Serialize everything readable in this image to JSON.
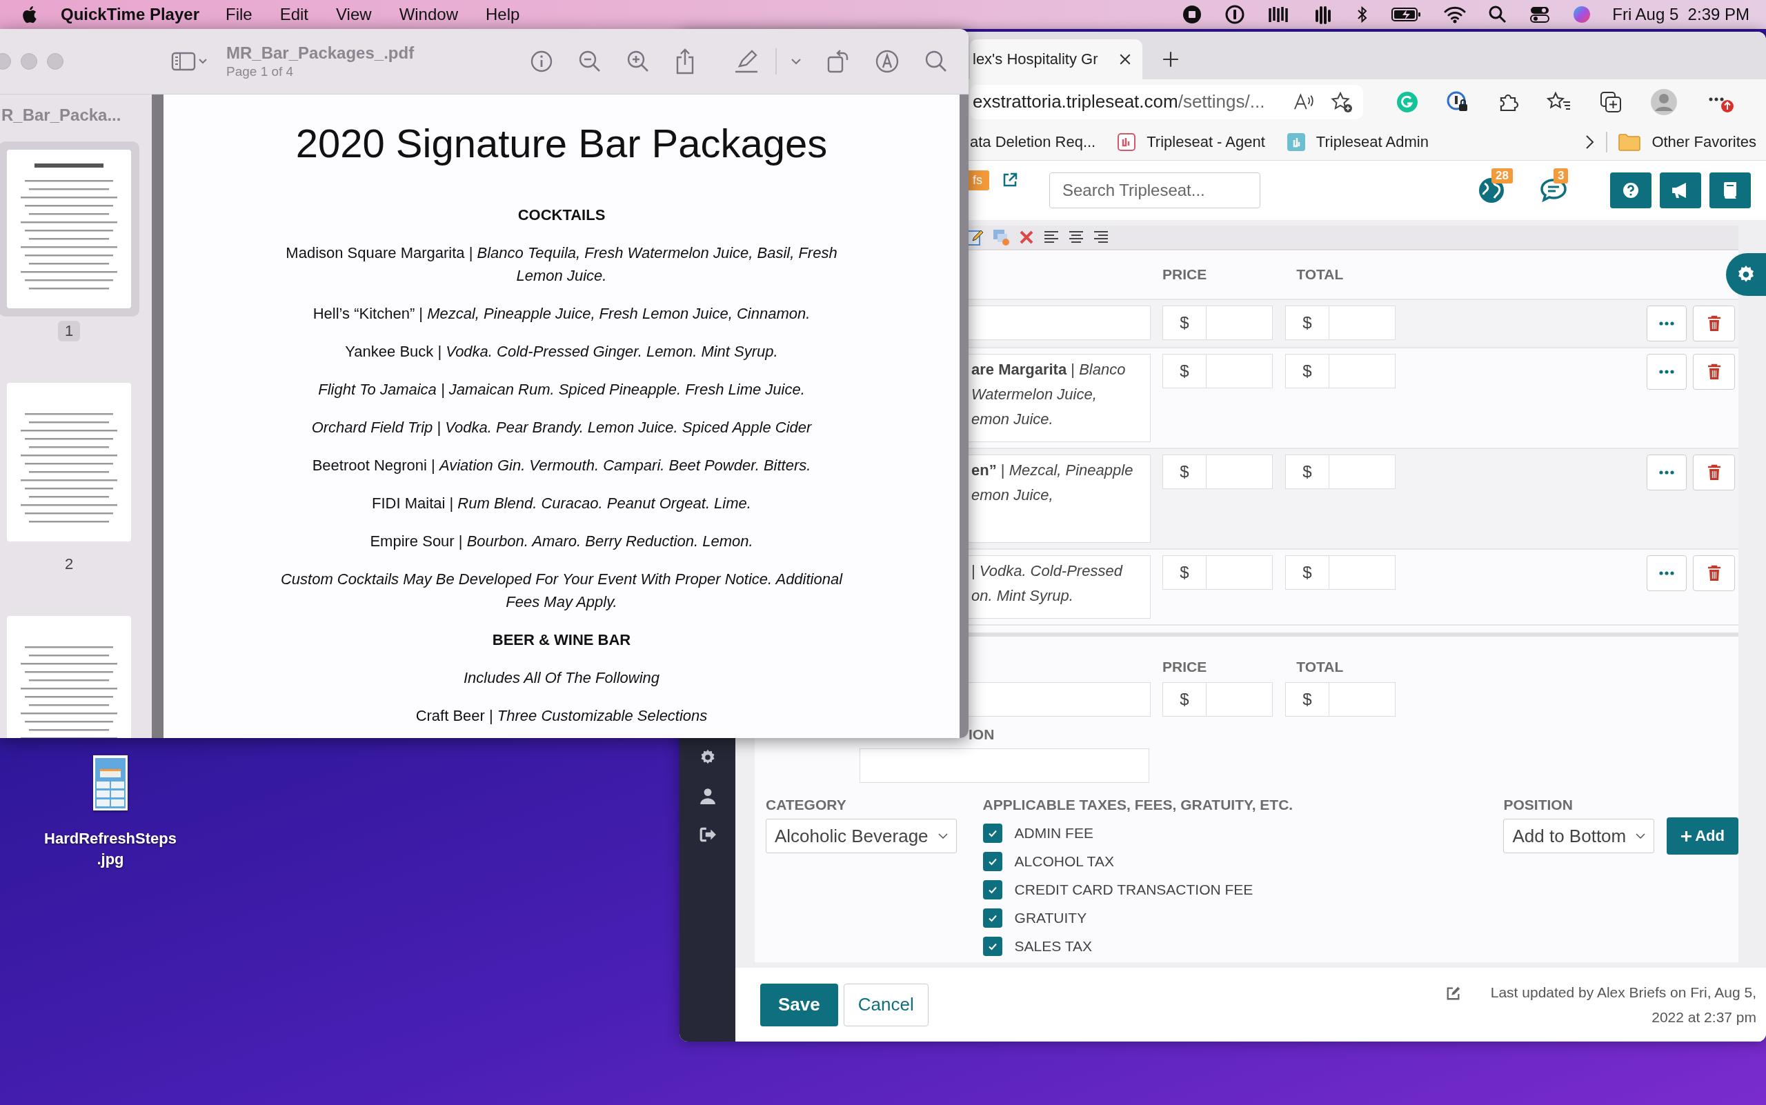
{
  "menubar": {
    "app": "QuickTime Player",
    "menus": [
      "File",
      "Edit",
      "View",
      "Window",
      "Help"
    ],
    "clock": "Fri Aug 5  2:39 PM"
  },
  "desktop": {
    "file_name": "HardRefreshSteps.jpg"
  },
  "preview": {
    "filename": "MR_Bar_Packages_.pdf",
    "page_info": "Page 1 of 4",
    "sidebar_title": "R_Bar_Packa...",
    "thumbnails": [
      {
        "number": "1",
        "selected": true
      },
      {
        "number": "2",
        "selected": false
      },
      {
        "selected": false
      }
    ],
    "document": {
      "title": "2020 Signature Bar Packages",
      "blocks": [
        {
          "kind": "heading",
          "text": "COCKTAILS"
        },
        {
          "kind": "item",
          "text": "Madison Square Margarita | *Blanco Tequila, Fresh Watermelon Juice, Basil, Fresh Lemon Juice.*"
        },
        {
          "kind": "item",
          "text": "Hell’s “Kitchen” | *Mezcal, Pineapple Juice, Fresh Lemon Juice, Cinnamon.*"
        },
        {
          "kind": "item",
          "text": "Yankee Buck | *Vodka. Cold-Pressed Ginger. Lemon. Mint Syrup.*"
        },
        {
          "kind": "note",
          "text": "Flight To Jamaica | Jamaican Rum. Spiced Pineapple. Fresh Lime Juice."
        },
        {
          "kind": "note",
          "text": "Orchard Field Trip | Vodka. Pear Brandy. Lemon Juice. Spiced Apple Cider"
        },
        {
          "kind": "item",
          "text": "Beetroot Negroni | *Aviation Gin. Vermouth. Campari. Beet Powder. Bitters.*"
        },
        {
          "kind": "item",
          "text": "FIDI Maitai | *Rum Blend. Curacao. Peanut Orgeat. Lime.*"
        },
        {
          "kind": "item",
          "text": "Empire Sour | *Bourbon. Amaro. Berry Reduction. Lemon.*"
        },
        {
          "kind": "note",
          "text": "Custom Cocktails May Be Developed For Your Event With Proper Notice. Additional Fees May Apply."
        },
        {
          "kind": "heading",
          "text": "BEER & WINE BAR"
        },
        {
          "kind": "note",
          "text": "Includes All Of The Following"
        },
        {
          "kind": "item",
          "text": "Craft Beer | *Three Customizable Selections*"
        }
      ]
    }
  },
  "browser": {
    "tab_title": "lex's Hospitality Gr",
    "url_host": "exstrattoria.tripleseat.com",
    "url_path": "/settings/...",
    "bookmarks": [
      {
        "label": "ata Deletion Req...",
        "kind": "plain"
      },
      {
        "label": "Tripleseat - Agent",
        "kind": "agent"
      },
      {
        "label": "Tripleseat Admin",
        "kind": "admin"
      }
    ],
    "other_favorites": "Other Favorites"
  },
  "app": {
    "header": {
      "tag": "fs",
      "search_placeholder": "Search Tripleseat...",
      "globe_count": "28",
      "chat_count": "3"
    },
    "columns": [
      "PRICE",
      "TOTAL"
    ],
    "rows": [
      {
        "price_symbol": "$",
        "total_symbol": "$"
      },
      {
        "lines": [
          "**are Margarita** | *Blanco*",
          "*Watermelon Juice,*",
          "*emon Juice.*"
        ],
        "price_symbol": "$",
        "total_symbol": "$"
      },
      {
        "lines": [
          "**en”** | *Mezcal, Pineapple*",
          "*emon Juice,*"
        ],
        "price_symbol": "$",
        "total_symbol": "$"
      },
      {
        "lines": [
          "| *Vodka. Cold-Pressed*",
          "*on. Mint Syrup.*"
        ],
        "price_symbol": "$",
        "total_symbol": "$"
      }
    ],
    "new_item": {
      "columns": [
        "PRICE",
        "TOTAL"
      ],
      "price_symbol": "$",
      "total_symbol": "$",
      "field_label": "ION"
    },
    "category": {
      "label": "CATEGORY",
      "value": "Alcoholic Beverage"
    },
    "taxes": {
      "label": "APPLICABLE TAXES, FEES, GRATUITY, ETC.",
      "items": [
        {
          "label": "ADMIN FEE",
          "checked": true
        },
        {
          "label": "ALCOHOL TAX",
          "checked": true
        },
        {
          "label": "CREDIT CARD TRANSACTION FEE",
          "checked": true
        },
        {
          "label": "GRATUITY",
          "checked": true
        },
        {
          "label": "SALES TAX",
          "checked": true
        }
      ]
    },
    "position": {
      "label": "POSITION",
      "value": "Add to Bottom"
    },
    "add_button": "Add",
    "footer": {
      "save": "Save",
      "cancel": "Cancel",
      "last_updated": "Last updated by Alex Briefs on Fri, Aug 5, 2022 at 2:37 pm"
    }
  }
}
